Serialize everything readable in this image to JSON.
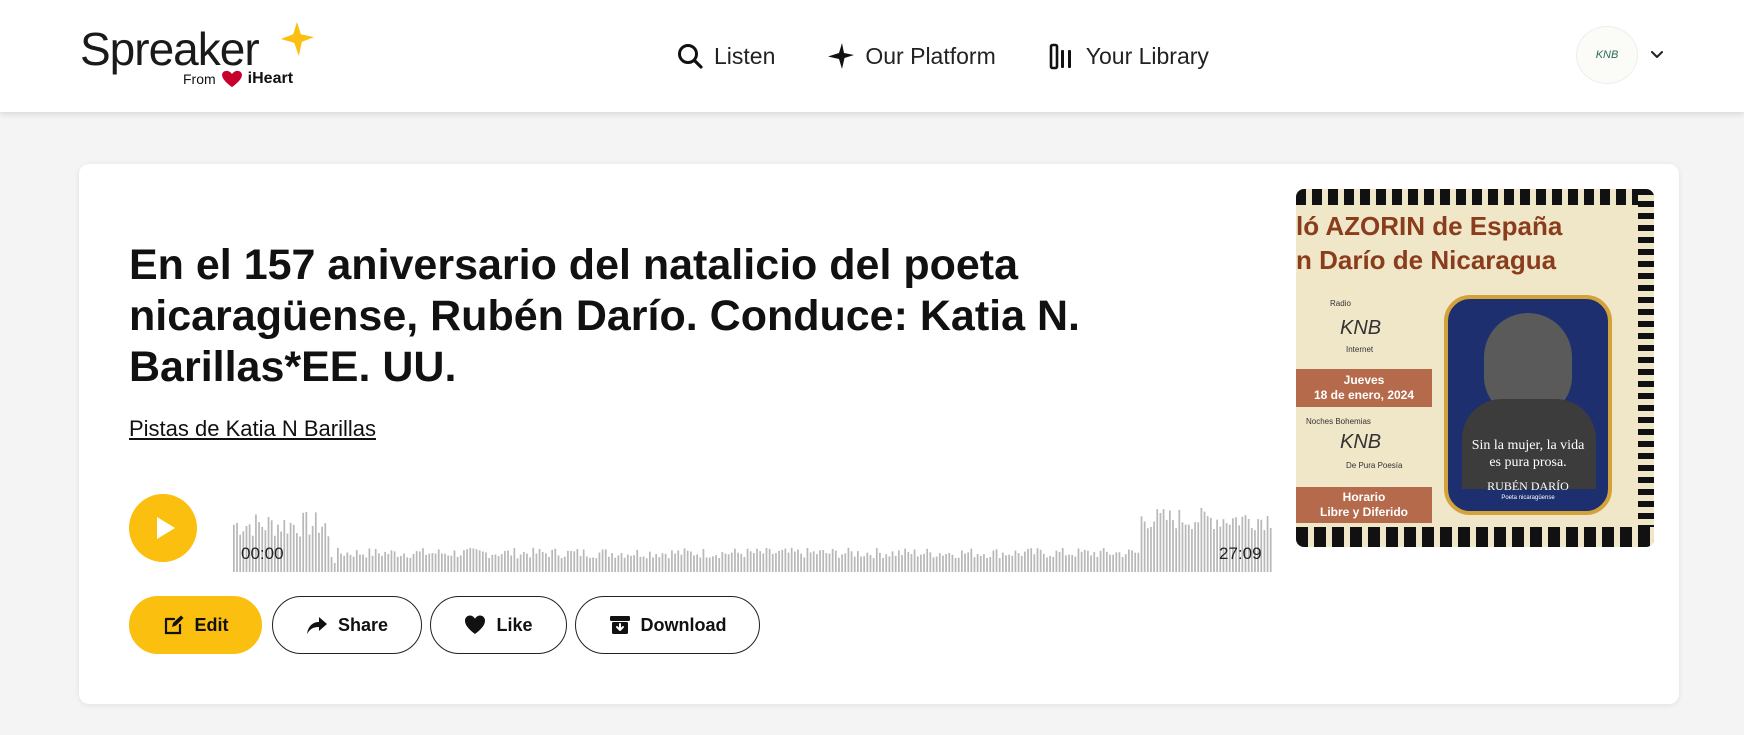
{
  "header": {
    "logo_word": "Spreaker",
    "logo_from": "From",
    "logo_brand": "iHeart",
    "nav": [
      {
        "label": "Listen",
        "icon": "search-icon"
      },
      {
        "label": "Our Platform",
        "icon": "star-icon"
      },
      {
        "label": "Your Library",
        "icon": "library-icon"
      }
    ],
    "avatar_text": "KNB"
  },
  "episode": {
    "title": "En el 157 aniversario del natalicio del poeta nicaragüense, Rubén Darío. Conduce: Katia N. Barillas*EE. UU.",
    "author_link": "Pistas de Katia N Barillas",
    "time_start": "00:00",
    "time_end": "27:09",
    "progress": 0
  },
  "actions": {
    "edit": "Edit",
    "share": "Share",
    "like": "Like",
    "download": "Download"
  },
  "cover": {
    "line1": "ló AZORIN de España",
    "line2": "n Darío de Nicaragua",
    "logo1_top": "Radio",
    "logo1_main": "KNB",
    "logo1_bottom": "Internet",
    "date_line1": "Jueves",
    "date_line2": "18 de enero, 2024",
    "logo2_top": "Noches Bohemias",
    "logo2_main": "KNB",
    "logo2_bottom": "De Pura Poesía",
    "horario_line1": "Horario",
    "horario_line2": "Libre y Diferido",
    "quote_line1": "Sin la mujer, la vida",
    "quote_line2": "es pura prosa.",
    "poet_name": "RUBÉN DARÍO",
    "poet_sub": "Poeta nicaragüense"
  },
  "colors": {
    "accent": "#fbbf0f",
    "wave": "#b8b8b8"
  }
}
